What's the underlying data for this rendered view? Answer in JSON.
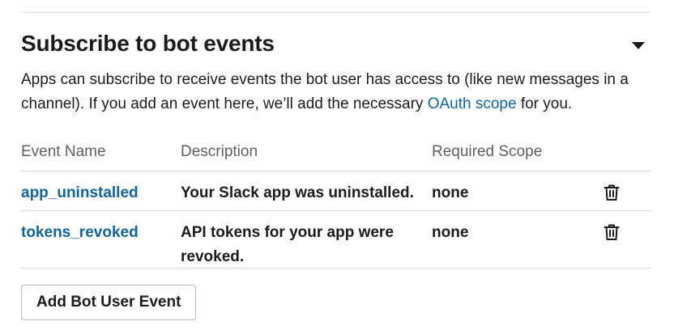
{
  "section": {
    "title": "Subscribe to bot events",
    "toggle_icon": "caret-down-icon"
  },
  "description": {
    "before_link": "Apps can subscribe to receive events the bot user has access to (like new messages in a channel). If you add an event here, we’ll add the necessary ",
    "link_text": "OAuth scope",
    "after_link": " for you."
  },
  "table": {
    "headers": {
      "name": "Event Name",
      "description": "Description",
      "scope": "Required Scope"
    },
    "rows": [
      {
        "name": "app_uninstalled",
        "description": "Your Slack app was uninstalled.",
        "scope": "none",
        "delete_icon": "trash-icon"
      },
      {
        "name": "tokens_revoked",
        "description": "API tokens for your app were revoked.",
        "scope": "none",
        "delete_icon": "trash-icon"
      }
    ]
  },
  "add_button": {
    "label": "Add Bot User Event"
  },
  "colors": {
    "link": "#1264a3",
    "text": "#1d1c1d",
    "muted": "#616061",
    "divider": "#dddddd"
  }
}
